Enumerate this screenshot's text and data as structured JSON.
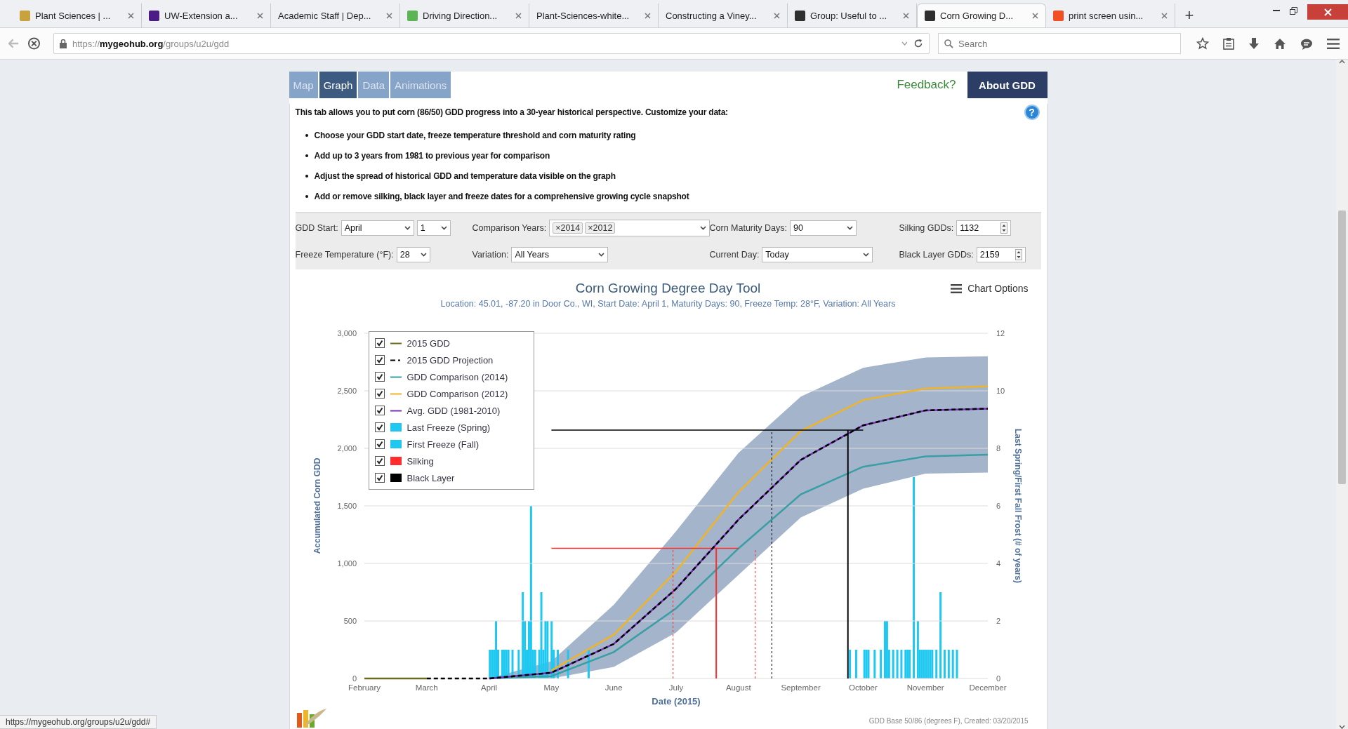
{
  "browser": {
    "tabs": [
      {
        "title": "Plant Sciences | ...",
        "color": "#c8a23c",
        "selected": false
      },
      {
        "title": "UW-Extension a...",
        "color": "#4b1c86",
        "selected": false
      },
      {
        "title": "Academic Staff | Dep...",
        "selected": false
      },
      {
        "title": "Driving Direction...",
        "color": "#5ab552",
        "selected": false
      },
      {
        "title": "Plant-Sciences-white...",
        "selected": false
      },
      {
        "title": "Constructing a Viney...",
        "selected": false
      },
      {
        "title": "Group: Useful to ...",
        "color": "#2f2f2f",
        "selected": false
      },
      {
        "title": "Corn Growing D...",
        "color": "#2f2f2f",
        "selected": true
      },
      {
        "title": "print screen usin...",
        "color": "#f25022",
        "selected": false
      }
    ],
    "new_tab": "+",
    "url": "https://**mygeohub.org**/groups/u2u/gdd",
    "search": {
      "placeholder": "Search"
    }
  },
  "page": {
    "tabs": [
      {
        "label": "Map",
        "selected": false
      },
      {
        "label": "Graph",
        "selected": true
      },
      {
        "label": "Data",
        "selected": false
      },
      {
        "label": "Animations",
        "selected": false
      }
    ],
    "feedback": "Feedback?",
    "about": "About GDD",
    "help": "?",
    "intro": "This tab allows you to put corn (86/50) GDD progress into a 30-year historical perspective. Customize your data:",
    "bullets": [
      "Choose your GDD start date, freeze temperature threshold and corn maturity rating",
      "Add up to 3 years from 1981 to previous year for comparison",
      "Adjust the spread of historical GDD and temperature data visible on the graph",
      "Add or remove silking, black layer and freeze dates for a comprehensive growing cycle snapshot"
    ],
    "controls": [
      [
        {
          "kind": "select",
          "label": "GDD Start:",
          "values": [
            "April",
            "1"
          ]
        },
        {
          "kind": "tags",
          "label": "Comparison Years:",
          "tags": [
            {
              "remove": "×",
              "label": "2014"
            },
            {
              "remove": "×",
              "label": "2012"
            }
          ]
        },
        {
          "kind": "select",
          "label": "Corn Maturity Days:",
          "values": [
            "90"
          ]
        },
        {
          "kind": "spinner",
          "label": "Silking GDDs:",
          "value": "1132"
        }
      ],
      [
        {
          "kind": "select",
          "label": "Freeze Temperature (°F):",
          "values": [
            "28"
          ]
        },
        {
          "kind": "select",
          "label": "Variation:",
          "values": [
            "All Years"
          ]
        },
        {
          "kind": "select",
          "label": "Current Day:",
          "values": [
            "Today"
          ]
        },
        {
          "kind": "spinner",
          "label": "Black Layer GDDs:",
          "value": "2159"
        }
      ]
    ],
    "chart": {
      "options": "Chart Options",
      "subtitle": "Location: 45.01, -87.20 in Door Co., WI, Start Date: April 1, Maturity Days: 90, Freeze Temp: 28°F, Variation: All Years",
      "chart_data": {
        "type": "line",
        "title": "Corn Growing Degree Day Tool",
        "xlabel": "Date (2015)",
        "ylabel": "Accumulated Corn GDD",
        "grid": true,
        "categories": [
          "February",
          "March",
          "April",
          "May",
          "June",
          "July",
          "August",
          "September",
          "October",
          "November",
          "December"
        ],
        "ylim": [
          0,
          3000
        ],
        "yticks": [
          {
            "value": 0,
            "label": "0"
          },
          {
            "value": 500,
            "label": "500"
          },
          {
            "value": 1000,
            "label": "1,000"
          },
          {
            "value": 1500,
            "label": "1,500"
          },
          {
            "value": 2000,
            "label": "2,000"
          },
          {
            "value": 2500,
            "label": "2,500"
          },
          {
            "value": 3000,
            "label": "3,000"
          }
        ],
        "series": [
          {
            "name": "2015 GDD",
            "color": "#6b6b20",
            "line_style": "solid",
            "values": [
              0,
              0,
              null,
              null,
              null,
              null,
              null,
              null,
              null,
              null,
              null
            ]
          },
          {
            "name": "2015 GDD Projection",
            "color": "#000000",
            "line_style": "dashed",
            "values": [
              null,
              0,
              0,
              50,
              300,
              780,
              1380,
              1900,
              2200,
              2330,
              2345
            ]
          },
          {
            "name": "GDD Comparison (2014)",
            "color": "#3a9ea5",
            "line_style": "solid",
            "values": [
              null,
              null,
              0,
              20,
              230,
              610,
              1130,
              1600,
              1840,
              1930,
              1945
            ]
          },
          {
            "name": "GDD Comparison (2012)",
            "color": "#f0b429",
            "line_style": "solid",
            "values": [
              null,
              null,
              null,
              70,
              380,
              930,
              1620,
              2150,
              2420,
              2520,
              2540
            ]
          },
          {
            "name": "Avg. GDD (1981-2010)",
            "color": "#7b2fbf",
            "line_style": "solid",
            "values": [
              null,
              null,
              0,
              50,
              300,
              780,
              1380,
              1900,
              2200,
              2330,
              2345
            ]
          },
          {
            "name": "Silking",
            "color": "#ff2d2d",
            "line_style": "solid",
            "values": [
              null,
              null,
              null,
              1132,
              1132,
              1132,
              1132,
              null,
              null,
              null,
              null
            ]
          },
          {
            "name": "Black Layer",
            "color": "#000000",
            "line_style": "solid",
            "values": [
              null,
              null,
              null,
              2159,
              2159,
              2159,
              2159,
              2159,
              2159,
              null,
              null
            ]
          }
        ]
      },
      "frost_axis": {
        "title": "Last Spring/First Fall Frost (# of years)",
        "ticks": [
          "12",
          "10",
          "8",
          "6",
          "4",
          "2",
          "0"
        ]
      },
      "legend": [
        {
          "checked": true,
          "kind": "line"
        },
        {
          "checked": true,
          "kind": "line"
        },
        {
          "checked": true,
          "kind": "line"
        },
        {
          "checked": true,
          "kind": "line"
        },
        {
          "checked": true,
          "kind": "line"
        },
        {
          "checked": true,
          "kind": "bar",
          "label": "Last Freeze (Spring)",
          "color": "#1ec8f0"
        },
        {
          "checked": true,
          "kind": "bar",
          "label": "First Freeze (Fall)",
          "color": "#1ec8f0"
        },
        {
          "checked": true,
          "kind": "marker"
        },
        {
          "checked": true,
          "kind": "marker"
        }
      ],
      "footer": "GDD Base 50/86 (degrees F), Created: 03/20/2015"
    }
  },
  "status_bar": "https://mygeohub.org/groups/u2u/gdd#"
}
